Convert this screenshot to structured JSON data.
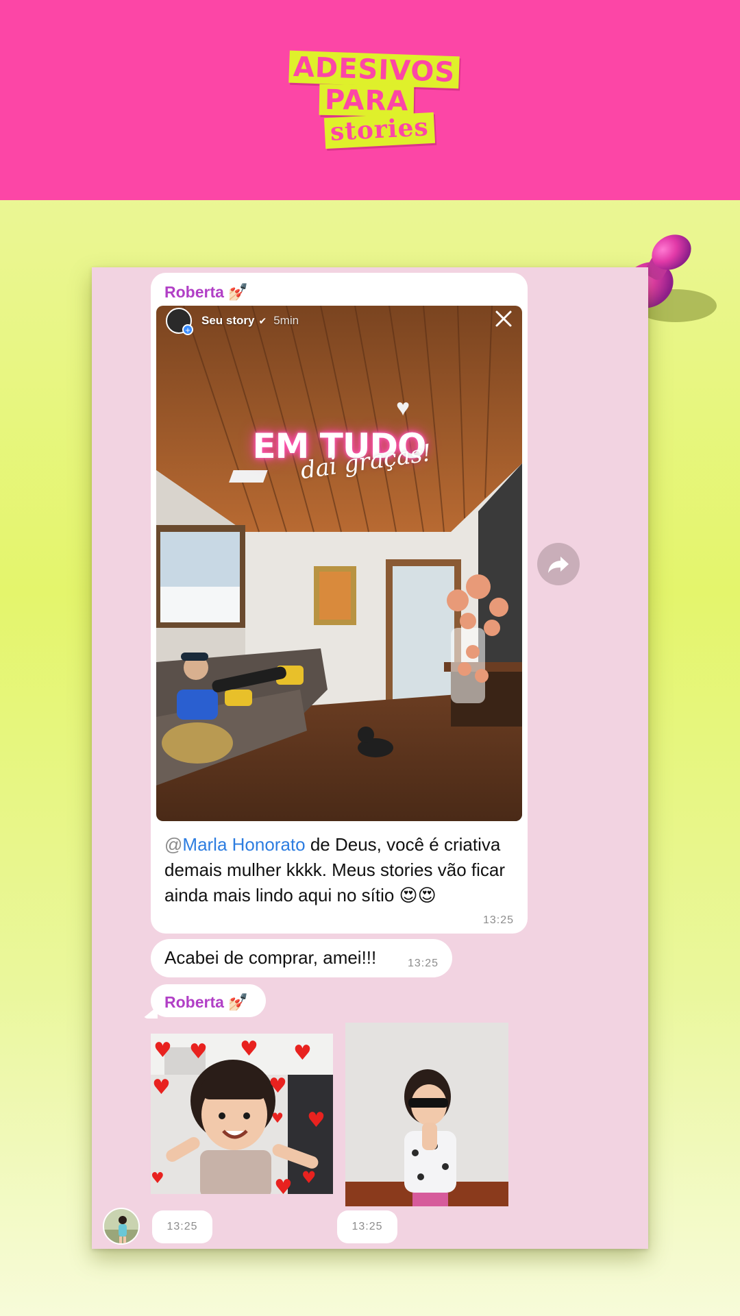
{
  "header": {
    "logo_line1": "ADESIVOS",
    "logo_line2": "PARA",
    "logo_line3": "stories",
    "background_color": "#fc46a6",
    "logo_color": "#dff02b"
  },
  "chat": {
    "sender_name": "Roberta",
    "sender_emoji": "💅🏻",
    "story": {
      "title": "Seu story",
      "time": "5min",
      "headline": "EM TUDO",
      "subheadline": "dai graças!"
    },
    "caption": {
      "mention_at": "@",
      "mention": "Marla Honorato",
      "text": " de Deus, você é criativa demais mulher kkkk. Meus stories vão ficar ainda mais lindo aqui no sítio 😍😍"
    },
    "message1_time": "13:25",
    "message2_text": "Acabei de comprar, amei!!!",
    "message2_time": "13:25",
    "media1_time": "13:25",
    "media2_time": "13:25",
    "icons": {
      "story_close": "close-icon",
      "forward": "forward-arrow-icon",
      "verified": "verified-badge-icon",
      "pin": "push-pin-icon"
    },
    "colors": {
      "card_background": "#f2d3e1",
      "sender_name": "#b13fc6",
      "mention": "#2d7de0"
    }
  }
}
